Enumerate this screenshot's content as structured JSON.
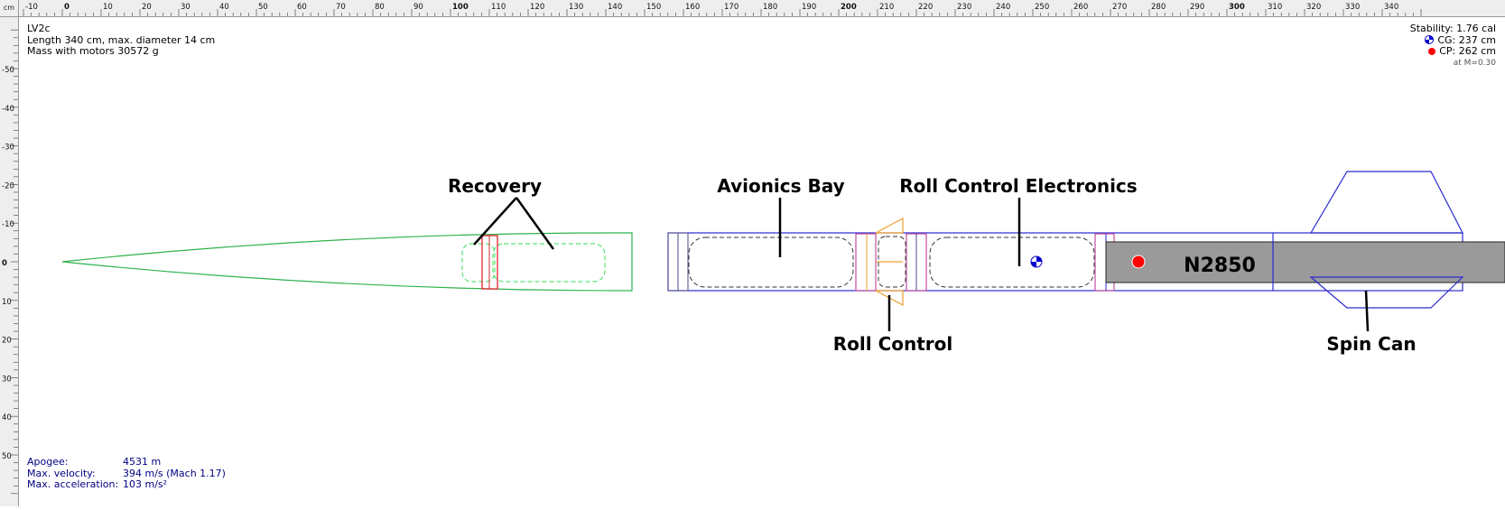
{
  "ruler": {
    "unit_label": "cm",
    "top_ticks": [
      "-10",
      "0",
      "10",
      "20",
      "30",
      "40",
      "50",
      "60",
      "70",
      "80",
      "90",
      "100",
      "110",
      "120",
      "130",
      "140",
      "150",
      "160",
      "170",
      "180",
      "190",
      "200",
      "210",
      "220",
      "230",
      "240",
      "250",
      "260",
      "270",
      "280",
      "290",
      "300",
      "310",
      "320",
      "330",
      "340"
    ],
    "left_ticks": [
      "-50",
      "-40",
      "-30",
      "-20",
      "-10",
      "0",
      "10",
      "20",
      "30",
      "40",
      "50"
    ]
  },
  "design": {
    "name": "LV2c",
    "length_line": "Length 340 cm, max. diameter 14 cm",
    "mass_line": "Mass with motors 30572 g"
  },
  "stability": {
    "line": "Stability: 1.76 cal",
    "cg": "CG:  237 cm",
    "cp": "CP:  262 cm",
    "mach": "at M=0.30"
  },
  "flight": {
    "apogee_label": "Apogee:",
    "apogee_value": "4531 m",
    "velocity_label": "Max. velocity:",
    "velocity_value": "394 m/s  (Mach 1.17)",
    "accel_label": "Max. acceleration:",
    "accel_value": "103 m/s²"
  },
  "annotations": {
    "recovery": "Recovery",
    "avionics": "Avionics Bay",
    "roll_electronics": "Roll Control Electronics",
    "roll_control": "Roll Control",
    "spin_can": "Spin Can",
    "motor": "N2850"
  },
  "colors": {
    "nose_body": "#2fb24a",
    "body": "#2b2bd1",
    "recovery_ring": "#e0252c",
    "roll_ring": "#c04fa0",
    "roll_fins": "#f0a030",
    "motor_fill": "#9a9a9a",
    "cg": "#0000cc",
    "cp": "#ff0000"
  }
}
